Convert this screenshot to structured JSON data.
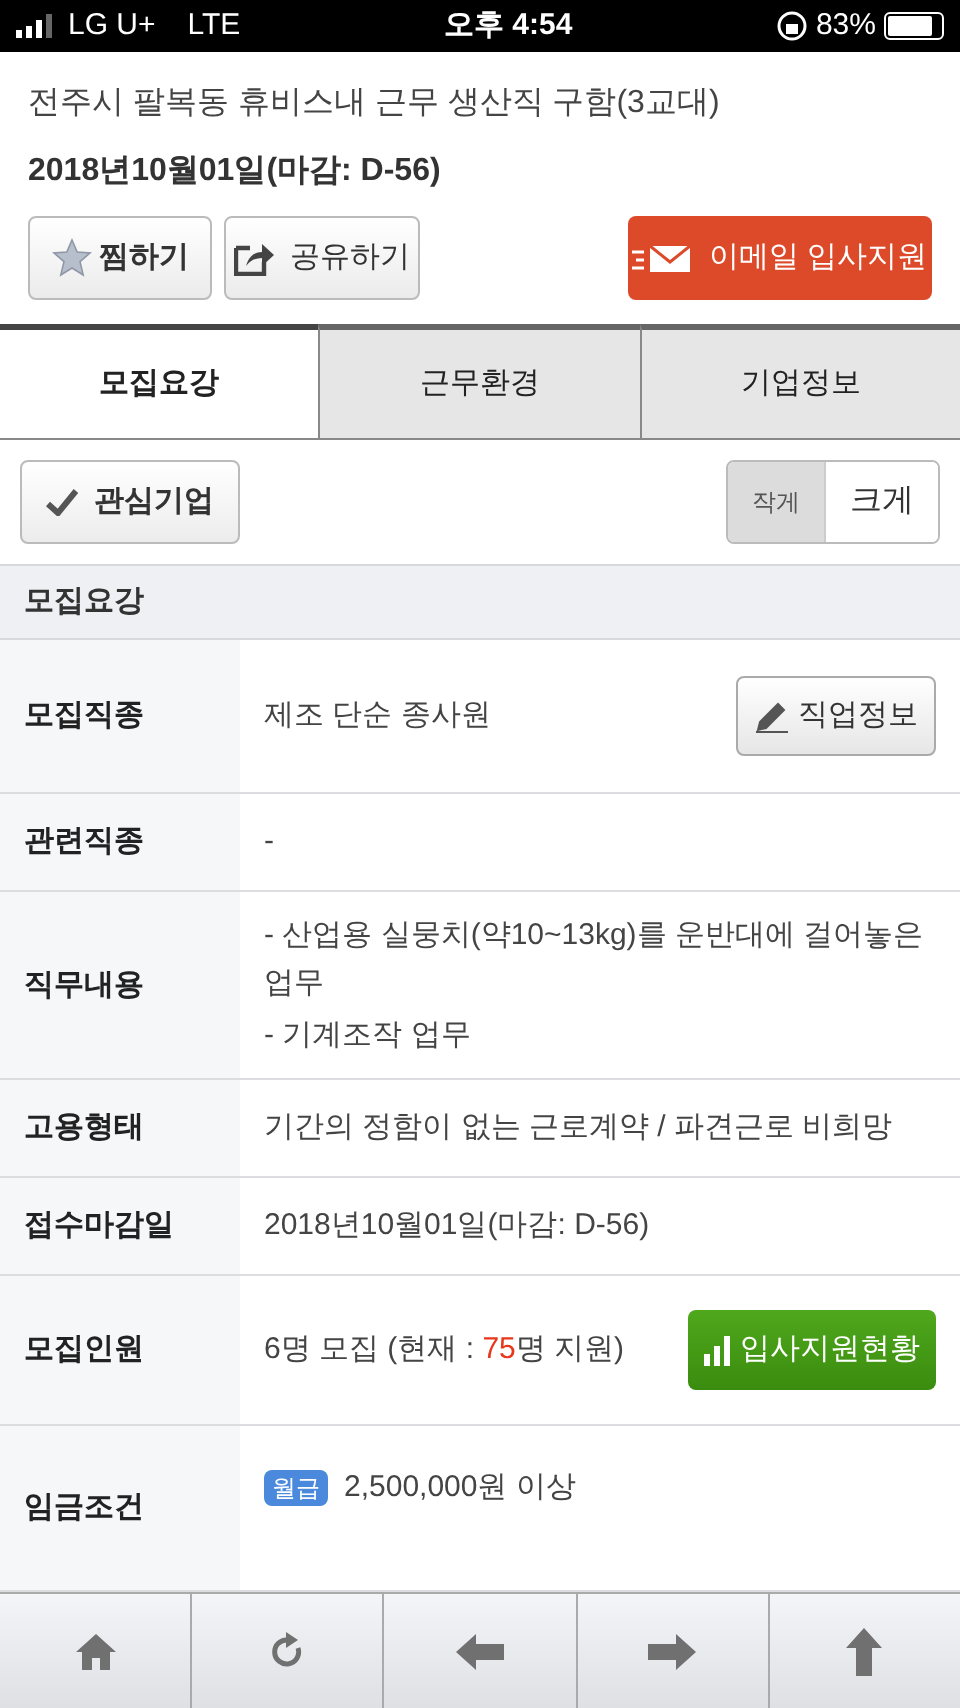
{
  "status_bar": {
    "carrier": "LG U+",
    "network": "LTE",
    "time": "오후 4:54",
    "battery": "83%"
  },
  "job": {
    "title": "전주시 팔복동 휴비스내 근무 생산직 구함(3교대)",
    "deadline": "2018년10월01일(마감: D-56)"
  },
  "actions": {
    "bookmark": "찜하기",
    "share": "공유하기",
    "apply": "이메일 입사지원"
  },
  "tabs": [
    {
      "label": "모집요강",
      "selected": true
    },
    {
      "label": "근무환경",
      "selected": false
    },
    {
      "label": "기업정보",
      "selected": false
    }
  ],
  "interest_button": "관심기업",
  "text_size": [
    {
      "label": "작게",
      "selected": true
    },
    {
      "label": "크게",
      "selected": false
    }
  ],
  "section_title": "모집요강",
  "rows": [
    {
      "kind": "button",
      "label": "모집직종",
      "value": "제조 단순 종사원",
      "button": "직업정보"
    },
    {
      "kind": "text",
      "label": "관련직종",
      "value": "-"
    },
    {
      "kind": "lines",
      "label": "직무내용",
      "lines": [
        "- 산업용 실뭉치(약10~13kg)를 운반대에 걸어놓은 업무",
        "- 기계조작 업무"
      ]
    },
    {
      "kind": "text",
      "label": "고용형태",
      "value": "기간의 정함이 없는 근로계약 / 파견근로 비희망"
    },
    {
      "kind": "text",
      "label": "접수마감일",
      "value": "2018년10월01일(마감: D-56)"
    },
    {
      "kind": "count",
      "label": "모집인원",
      "before": "6명 모집 (현재 : ",
      "highlight": "75",
      "after": "명 지원)",
      "button": "입사지원현황"
    },
    {
      "kind": "salary",
      "label": "임금조건",
      "badge": "월급",
      "value": "2,500,000원 이상"
    }
  ],
  "toolbar": [
    {
      "kind": "home"
    },
    {
      "kind": "reload"
    },
    {
      "kind": "back"
    },
    {
      "kind": "forward"
    },
    {
      "kind": "up"
    }
  ]
}
